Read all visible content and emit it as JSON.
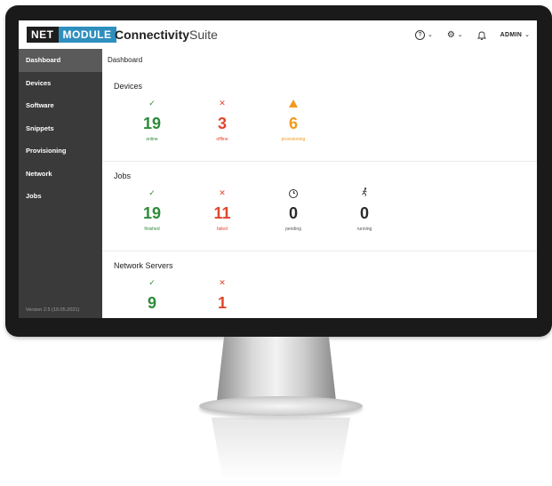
{
  "header": {
    "logo_net": "NET",
    "logo_module": "MODULE",
    "app_name_bold": "Connectivity",
    "app_name_light": "Suite",
    "help_icon": "?",
    "admin_label": "ADMIN"
  },
  "sidebar": {
    "items": [
      {
        "label": "Dashboard"
      },
      {
        "label": "Devices"
      },
      {
        "label": "Software"
      },
      {
        "label": "Snippets"
      },
      {
        "label": "Provisioning"
      },
      {
        "label": "Network"
      },
      {
        "label": "Jobs"
      }
    ],
    "version": "Version 2.5 (19.05.2021)"
  },
  "main": {
    "breadcrumb": "Dashboard",
    "devices": {
      "title": "Devices",
      "stats": [
        {
          "icon": "check-icon",
          "value": "19",
          "label": "online",
          "color": "#2e8b3a"
        },
        {
          "icon": "cross-icon",
          "value": "3",
          "label": "offline",
          "color": "#e2452b"
        },
        {
          "icon": "warning-icon",
          "value": "6",
          "label": "provisioning",
          "color": "#f29a1f"
        }
      ]
    },
    "jobs": {
      "title": "Jobs",
      "stats": [
        {
          "icon": "check-icon",
          "value": "19",
          "label": "finished",
          "color": "#2e8b3a"
        },
        {
          "icon": "cross-icon",
          "value": "11",
          "label": "failed",
          "color": "#e2452b"
        },
        {
          "icon": "clock-icon",
          "value": "0",
          "label": "pending",
          "color": "#2a2a2a"
        },
        {
          "icon": "running-icon",
          "value": "0",
          "label": "running",
          "color": "#2a2a2a"
        }
      ]
    },
    "network_servers": {
      "title": "Network Servers",
      "stats": [
        {
          "icon": "check-icon",
          "value": "9",
          "color": "#2e8b3a"
        },
        {
          "icon": "cross-icon",
          "value": "1",
          "color": "#e2452b"
        }
      ]
    }
  }
}
